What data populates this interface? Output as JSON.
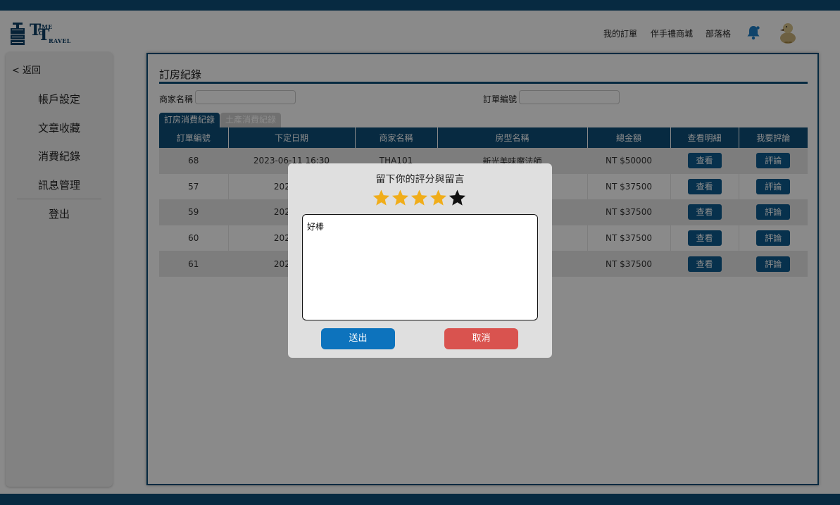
{
  "colors": {
    "brand": "#0d4e79",
    "submit": "#0d73bd",
    "cancel": "#d9534f",
    "star_filled": "#f0ad1a",
    "star_empty": "#111111"
  },
  "header": {
    "logo": {
      "big_t1": "T",
      "small1": "IME",
      "small2": "O",
      "big_t2": "T",
      "small3": "RAVEL",
      "mark_text": "TIME TO TRAVEL"
    },
    "nav": [
      "我的訂單",
      "伴手禮商城",
      "部落格"
    ],
    "icons": {
      "bell": "bell-icon",
      "avatar": "duck-avatar"
    }
  },
  "sidebar": {
    "back": "< 返回",
    "items": [
      "帳戶設定",
      "文章收藏",
      "消費紀錄",
      "訊息管理",
      "登出"
    ]
  },
  "main": {
    "title": "訂房紀錄",
    "filters": {
      "store_label": "商家名稱",
      "order_label": "訂單編號",
      "store_value": "",
      "order_value": ""
    },
    "tabs": [
      "訂房消費紀錄",
      "土產消費紀錄"
    ],
    "table": {
      "headers": [
        "訂單編號",
        "下定日期",
        "商家名稱",
        "房型名稱",
        "總金額",
        "查看明細",
        "我要評論"
      ],
      "view_label": "查看",
      "comment_label": "評論",
      "rows": [
        {
          "id": "68",
          "date": "2023-06-11 16:30",
          "store": "THA101",
          "room": "新光美味魔法師",
          "total": "NT $50000"
        },
        {
          "id": "57",
          "date": "2023-06",
          "store": "",
          "room": "",
          "total": "NT $37500"
        },
        {
          "id": "59",
          "date": "2023-06",
          "store": "",
          "room": "",
          "total": "NT $37500"
        },
        {
          "id": "60",
          "date": "2023-06",
          "store": "",
          "room": "",
          "total": "NT $37500"
        },
        {
          "id": "61",
          "date": "2023-06",
          "store": "",
          "room": "",
          "total": "NT $37500"
        }
      ]
    }
  },
  "modal": {
    "title": "留下你的評分與留言",
    "rating": 4,
    "max_rating": 5,
    "comment": "好棒",
    "submit_label": "送出",
    "cancel_label": "取消"
  }
}
